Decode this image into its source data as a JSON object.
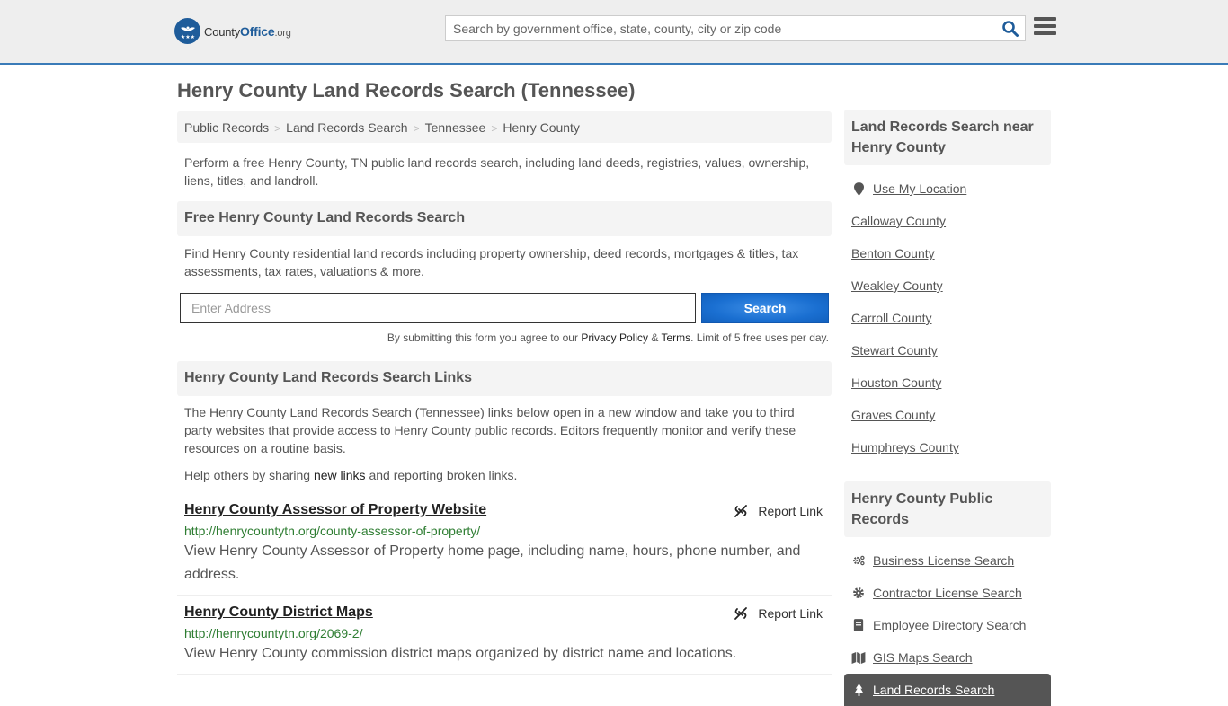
{
  "header": {
    "logo": {
      "county": "County",
      "office": "Office",
      "tld": ".org"
    },
    "search_placeholder": "Search by government office, state, county, city or zip code",
    "search_icon": "search-icon",
    "menu_icon": "hamburger-menu-icon"
  },
  "page_title": "Henry County Land Records Search (Tennessee)",
  "breadcrumb": [
    "Public Records",
    "Land Records Search",
    "Tennessee",
    "Henry County"
  ],
  "breadcrumb_separator": ">",
  "intro": "Perform a free Henry County, TN public land records search, including land deeds, registries, values, ownership, liens, titles, and landroll.",
  "search_section": {
    "heading": "Free Henry County Land Records Search",
    "description": "Find Henry County residential land records including property ownership, deed records, mortgages & titles, tax assessments, tax rates, valuations & more.",
    "input_placeholder": "Enter Address",
    "input_value": "",
    "button_label": "Search",
    "disclaimer": {
      "prefix": "By submitting this form you agree to our ",
      "privacy": "Privacy Policy",
      "amp": " & ",
      "terms": "Terms",
      "suffix": ". Limit of 5 free uses per day."
    }
  },
  "links_section": {
    "heading": "Henry County Land Records Search Links",
    "description": "The Henry County Land Records Search (Tennessee) links below open in a new window and take you to third party websites that provide access to Henry County public records. Editors frequently monitor and verify these resources on a routine basis.",
    "help_prefix": "Help others by sharing ",
    "help_link": "new links",
    "help_suffix": " and reporting broken links.",
    "report_label": "Report Link",
    "items": [
      {
        "title": "Henry County Assessor of Property Website",
        "url": "http://henrycountytn.org/county-assessor-of-property/",
        "description": "View Henry County Assessor of Property home page, including name, hours, phone number, and address."
      },
      {
        "title": "Henry County District Maps",
        "url": "http://henrycountytn.org/2069-2/",
        "description": "View Henry County commission district maps organized by district name and locations."
      }
    ]
  },
  "sidebar": {
    "nearby_heading": "Land Records Search near Henry County",
    "use_location": "Use My Location",
    "nearby": [
      "Calloway County",
      "Benton County",
      "Weakley County",
      "Carroll County",
      "Stewart County",
      "Houston County",
      "Graves County",
      "Humphreys County"
    ],
    "public_records_heading": "Henry County Public Records",
    "public_records": [
      {
        "label": "Business License Search",
        "icon": "gears-icon"
      },
      {
        "label": "Contractor License Search",
        "icon": "gear-icon"
      },
      {
        "label": "Employee Directory Search",
        "icon": "book-icon"
      },
      {
        "label": "GIS Maps Search",
        "icon": "map-icon"
      },
      {
        "label": "Land Records Search",
        "icon": "tree-icon",
        "active": true
      }
    ]
  },
  "colors": {
    "accent_blue": "#1a6fd1",
    "header_border": "#3a7bb8",
    "url_green": "#2e7d32",
    "active_bg": "#555555"
  }
}
